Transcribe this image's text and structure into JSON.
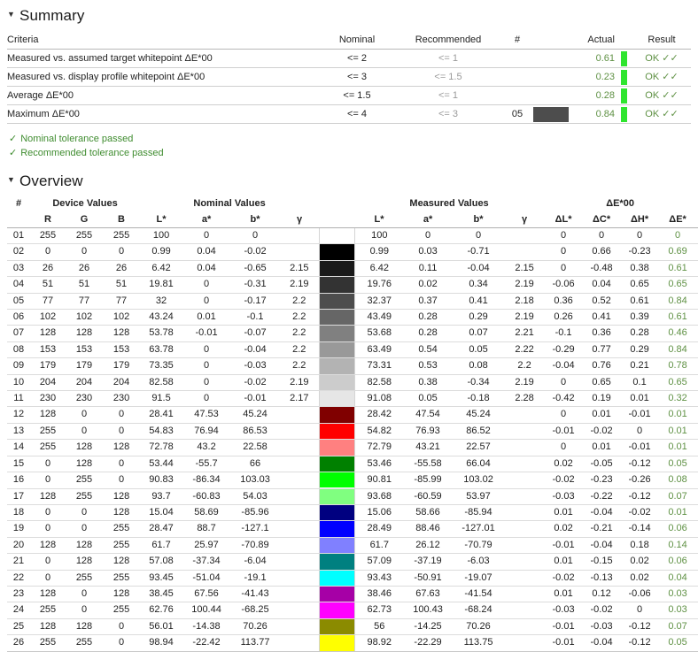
{
  "summary": {
    "heading": "Summary",
    "triangle": "▼",
    "columns": [
      "Criteria",
      "Nominal",
      "Recommended",
      "#",
      "",
      "Actual",
      "",
      "Result"
    ],
    "rows": [
      {
        "criteria": "Measured vs. assumed target whitepoint ΔE*00",
        "nominal": "<= 2",
        "recommended": "<= 1",
        "num": "",
        "swatch": "",
        "actual": "0.61",
        "bar": "#2fe52f",
        "result": "OK ✓✓"
      },
      {
        "criteria": "Measured vs. display profile whitepoint ΔE*00",
        "nominal": "<= 3",
        "recommended": "<= 1.5",
        "num": "",
        "swatch": "",
        "actual": "0.23",
        "bar": "#2fe52f",
        "result": "OK ✓✓"
      },
      {
        "criteria": "Average ΔE*00",
        "nominal": "<= 1.5",
        "recommended": "<= 1",
        "num": "",
        "swatch": "",
        "actual": "0.28",
        "bar": "#2fe52f",
        "result": "OK ✓✓"
      },
      {
        "criteria": "Maximum ΔE*00",
        "nominal": "<= 4",
        "recommended": "<= 3",
        "num": "05",
        "swatch": "#4d4d4d",
        "actual": "0.84",
        "bar": "#2fe52f",
        "result": "OK ✓✓"
      }
    ],
    "notes": [
      {
        "check": "✓",
        "text": "Nominal tolerance passed"
      },
      {
        "check": "✓",
        "text": "Recommended tolerance passed"
      }
    ]
  },
  "overview": {
    "heading": "Overview",
    "triangle": "▼",
    "group_headers": {
      "index": "#",
      "device": "Device Values",
      "nominal": "Nominal Values",
      "swatch": "",
      "measured": "Measured Values",
      "delta": "ΔE*00"
    },
    "sub_headers": {
      "index": "",
      "r": "R",
      "g": "G",
      "b": "B",
      "nL": "L*",
      "na": "a*",
      "nb": "b*",
      "ng": "γ",
      "swatch": "",
      "mL": "L*",
      "ma": "a*",
      "mb": "b*",
      "mg": "γ",
      "dL": "ΔL*",
      "dC": "ΔC*",
      "dH": "ΔH*",
      "dE": "ΔE*",
      "bar": ""
    },
    "rows": [
      {
        "idx": "01",
        "r": "255",
        "g": "255",
        "b": "255",
        "nL": "100",
        "na": "0",
        "nb": "0",
        "ng": "",
        "swatch": "",
        "mL": "100",
        "ma": "0",
        "mb": "0",
        "mg": "",
        "dL": "0",
        "dC": "0",
        "dH": "0",
        "dE": "0",
        "bar": ""
      },
      {
        "idx": "02",
        "r": "0",
        "g": "0",
        "b": "0",
        "nL": "0.99",
        "na": "0.04",
        "nb": "-0.02",
        "ng": "",
        "swatch": "#000000",
        "mL": "0.99",
        "ma": "0.03",
        "mb": "-0.71",
        "mg": "",
        "dL": "0",
        "dC": "0.66",
        "dH": "-0.23",
        "dE": "0.69",
        "bar": "#2fe52f"
      },
      {
        "idx": "03",
        "r": "26",
        "g": "26",
        "b": "26",
        "nL": "6.42",
        "na": "0.04",
        "nb": "-0.65",
        "ng": "2.15",
        "swatch": "#1a1a1a",
        "mL": "6.42",
        "ma": "0.11",
        "mb": "-0.04",
        "mg": "2.15",
        "dL": "0",
        "dC": "-0.48",
        "dH": "0.38",
        "dE": "0.61",
        "bar": "#2fe52f"
      },
      {
        "idx": "04",
        "r": "51",
        "g": "51",
        "b": "51",
        "nL": "19.81",
        "na": "0",
        "nb": "-0.31",
        "ng": "2.19",
        "swatch": "#333333",
        "mL": "19.76",
        "ma": "0.02",
        "mb": "0.34",
        "mg": "2.19",
        "dL": "-0.06",
        "dC": "0.04",
        "dH": "0.65",
        "dE": "0.65",
        "bar": "#2fe52f"
      },
      {
        "idx": "05",
        "r": "77",
        "g": "77",
        "b": "77",
        "nL": "32",
        "na": "0",
        "nb": "-0.17",
        "ng": "2.2",
        "swatch": "#4d4d4d",
        "mL": "32.37",
        "ma": "0.37",
        "mb": "0.41",
        "mg": "2.18",
        "dL": "0.36",
        "dC": "0.52",
        "dH": "0.61",
        "dE": "0.84",
        "bar": "#2fe52f"
      },
      {
        "idx": "06",
        "r": "102",
        "g": "102",
        "b": "102",
        "nL": "43.24",
        "na": "0.01",
        "nb": "-0.1",
        "ng": "2.2",
        "swatch": "#666666",
        "mL": "43.49",
        "ma": "0.28",
        "mb": "0.29",
        "mg": "2.19",
        "dL": "0.26",
        "dC": "0.41",
        "dH": "0.39",
        "dE": "0.61",
        "bar": "#2fe52f"
      },
      {
        "idx": "07",
        "r": "128",
        "g": "128",
        "b": "128",
        "nL": "53.78",
        "na": "-0.01",
        "nb": "-0.07",
        "ng": "2.2",
        "swatch": "#808080",
        "mL": "53.68",
        "ma": "0.28",
        "mb": "0.07",
        "mg": "2.21",
        "dL": "-0.1",
        "dC": "0.36",
        "dH": "0.28",
        "dE": "0.46",
        "bar": "#2fe52f"
      },
      {
        "idx": "08",
        "r": "153",
        "g": "153",
        "b": "153",
        "nL": "63.78",
        "na": "0",
        "nb": "-0.04",
        "ng": "2.2",
        "swatch": "#999999",
        "mL": "63.49",
        "ma": "0.54",
        "mb": "0.05",
        "mg": "2.22",
        "dL": "-0.29",
        "dC": "0.77",
        "dH": "0.29",
        "dE": "0.84",
        "bar": "#2fe52f"
      },
      {
        "idx": "09",
        "r": "179",
        "g": "179",
        "b": "179",
        "nL": "73.35",
        "na": "0",
        "nb": "-0.03",
        "ng": "2.2",
        "swatch": "#b3b3b3",
        "mL": "73.31",
        "ma": "0.53",
        "mb": "0.08",
        "mg": "2.2",
        "dL": "-0.04",
        "dC": "0.76",
        "dH": "0.21",
        "dE": "0.78",
        "bar": "#2fe52f"
      },
      {
        "idx": "10",
        "r": "204",
        "g": "204",
        "b": "204",
        "nL": "82.58",
        "na": "0",
        "nb": "-0.02",
        "ng": "2.19",
        "swatch": "#cccccc",
        "mL": "82.58",
        "ma": "0.38",
        "mb": "-0.34",
        "mg": "2.19",
        "dL": "0",
        "dC": "0.65",
        "dH": "0.1",
        "dE": "0.65",
        "bar": "#2fe52f"
      },
      {
        "idx": "11",
        "r": "230",
        "g": "230",
        "b": "230",
        "nL": "91.5",
        "na": "0",
        "nb": "-0.01",
        "ng": "2.17",
        "swatch": "#e6e6e6",
        "mL": "91.08",
        "ma": "0.05",
        "mb": "-0.18",
        "mg": "2.28",
        "dL": "-0.42",
        "dC": "0.19",
        "dH": "0.01",
        "dE": "0.32",
        "bar": "#2fe52f"
      },
      {
        "idx": "12",
        "r": "128",
        "g": "0",
        "b": "0",
        "nL": "28.41",
        "na": "47.53",
        "nb": "45.24",
        "ng": "",
        "swatch": "#800000",
        "mL": "28.42",
        "ma": "47.54",
        "mb": "45.24",
        "mg": "",
        "dL": "0",
        "dC": "0.01",
        "dH": "-0.01",
        "dE": "0.01",
        "bar": ""
      },
      {
        "idx": "13",
        "r": "255",
        "g": "0",
        "b": "0",
        "nL": "54.83",
        "na": "76.94",
        "nb": "86.53",
        "ng": "",
        "swatch": "#ff0000",
        "mL": "54.82",
        "ma": "76.93",
        "mb": "86.52",
        "mg": "",
        "dL": "-0.01",
        "dC": "-0.02",
        "dH": "0",
        "dE": "0.01",
        "bar": ""
      },
      {
        "idx": "14",
        "r": "255",
        "g": "128",
        "b": "128",
        "nL": "72.78",
        "na": "43.2",
        "nb": "22.58",
        "ng": "",
        "swatch": "#ff8080",
        "mL": "72.79",
        "ma": "43.21",
        "mb": "22.57",
        "mg": "",
        "dL": "0",
        "dC": "0.01",
        "dH": "-0.01",
        "dE": "0.01",
        "bar": ""
      },
      {
        "idx": "15",
        "r": "0",
        "g": "128",
        "b": "0",
        "nL": "53.44",
        "na": "-55.7",
        "nb": "66",
        "ng": "",
        "swatch": "#008000",
        "mL": "53.46",
        "ma": "-55.58",
        "mb": "66.04",
        "mg": "",
        "dL": "0.02",
        "dC": "-0.05",
        "dH": "-0.12",
        "dE": "0.05",
        "bar": "#2fe52f"
      },
      {
        "idx": "16",
        "r": "0",
        "g": "255",
        "b": "0",
        "nL": "90.83",
        "na": "-86.34",
        "nb": "103.03",
        "ng": "",
        "swatch": "#00ff00",
        "mL": "90.81",
        "ma": "-85.99",
        "mb": "103.02",
        "mg": "",
        "dL": "-0.02",
        "dC": "-0.23",
        "dH": "-0.26",
        "dE": "0.08",
        "bar": "#2fe52f"
      },
      {
        "idx": "17",
        "r": "128",
        "g": "255",
        "b": "128",
        "nL": "93.7",
        "na": "-60.83",
        "nb": "54.03",
        "ng": "",
        "swatch": "#80ff80",
        "mL": "93.68",
        "ma": "-60.59",
        "mb": "53.97",
        "mg": "",
        "dL": "-0.03",
        "dC": "-0.22",
        "dH": "-0.12",
        "dE": "0.07",
        "bar": "#2fe52f"
      },
      {
        "idx": "18",
        "r": "0",
        "g": "0",
        "b": "128",
        "nL": "15.04",
        "na": "58.69",
        "nb": "-85.96",
        "ng": "",
        "swatch": "#000080",
        "mL": "15.06",
        "ma": "58.66",
        "mb": "-85.94",
        "mg": "",
        "dL": "0.01",
        "dC": "-0.04",
        "dH": "-0.02",
        "dE": "0.01",
        "bar": ""
      },
      {
        "idx": "19",
        "r": "0",
        "g": "0",
        "b": "255",
        "nL": "28.47",
        "na": "88.7",
        "nb": "-127.1",
        "ng": "",
        "swatch": "#0000ff",
        "mL": "28.49",
        "ma": "88.46",
        "mb": "-127.01",
        "mg": "",
        "dL": "0.02",
        "dC": "-0.21",
        "dH": "-0.14",
        "dE": "0.06",
        "bar": "#2fe52f"
      },
      {
        "idx": "20",
        "r": "128",
        "g": "128",
        "b": "255",
        "nL": "61.7",
        "na": "25.97",
        "nb": "-70.89",
        "ng": "",
        "swatch": "#8080ff",
        "mL": "61.7",
        "ma": "26.12",
        "mb": "-70.79",
        "mg": "",
        "dL": "-0.01",
        "dC": "-0.04",
        "dH": "0.18",
        "dE": "0.14",
        "bar": "#2fe52f"
      },
      {
        "idx": "21",
        "r": "0",
        "g": "128",
        "b": "128",
        "nL": "57.08",
        "na": "-37.34",
        "nb": "-6.04",
        "ng": "",
        "swatch": "#008080",
        "mL": "57.09",
        "ma": "-37.19",
        "mb": "-6.03",
        "mg": "",
        "dL": "0.01",
        "dC": "-0.15",
        "dH": "0.02",
        "dE": "0.06",
        "bar": "#2fe52f"
      },
      {
        "idx": "22",
        "r": "0",
        "g": "255",
        "b": "255",
        "nL": "93.45",
        "na": "-51.04",
        "nb": "-19.1",
        "ng": "",
        "swatch": "#00ffff",
        "mL": "93.43",
        "ma": "-50.91",
        "mb": "-19.07",
        "mg": "",
        "dL": "-0.02",
        "dC": "-0.13",
        "dH": "0.02",
        "dE": "0.04",
        "bar": "#2fe52f"
      },
      {
        "idx": "23",
        "r": "128",
        "g": "0",
        "b": "128",
        "nL": "38.45",
        "na": "67.56",
        "nb": "-41.43",
        "ng": "",
        "swatch": "#a600a6",
        "mL": "38.46",
        "ma": "67.63",
        "mb": "-41.54",
        "mg": "",
        "dL": "0.01",
        "dC": "0.12",
        "dH": "-0.06",
        "dE": "0.03",
        "bar": ""
      },
      {
        "idx": "24",
        "r": "255",
        "g": "0",
        "b": "255",
        "nL": "62.76",
        "na": "100.44",
        "nb": "-68.25",
        "ng": "",
        "swatch": "#ff00ff",
        "mL": "62.73",
        "ma": "100.43",
        "mb": "-68.24",
        "mg": "",
        "dL": "-0.03",
        "dC": "-0.02",
        "dH": "0",
        "dE": "0.03",
        "bar": ""
      },
      {
        "idx": "25",
        "r": "128",
        "g": "128",
        "b": "0",
        "nL": "56.01",
        "na": "-14.38",
        "nb": "70.26",
        "ng": "",
        "swatch": "#8b8b00",
        "mL": "56",
        "ma": "-14.25",
        "mb": "70.26",
        "mg": "",
        "dL": "-0.01",
        "dC": "-0.03",
        "dH": "-0.12",
        "dE": "0.07",
        "bar": "#2fe52f"
      },
      {
        "idx": "26",
        "r": "255",
        "g": "255",
        "b": "0",
        "nL": "98.94",
        "na": "-22.42",
        "nb": "113.77",
        "ng": "",
        "swatch": "#ffff00",
        "mL": "98.92",
        "ma": "-22.29",
        "mb": "113.75",
        "mg": "",
        "dL": "-0.01",
        "dC": "-0.04",
        "dH": "-0.12",
        "dE": "0.05",
        "bar": "#2fe52f"
      }
    ]
  }
}
